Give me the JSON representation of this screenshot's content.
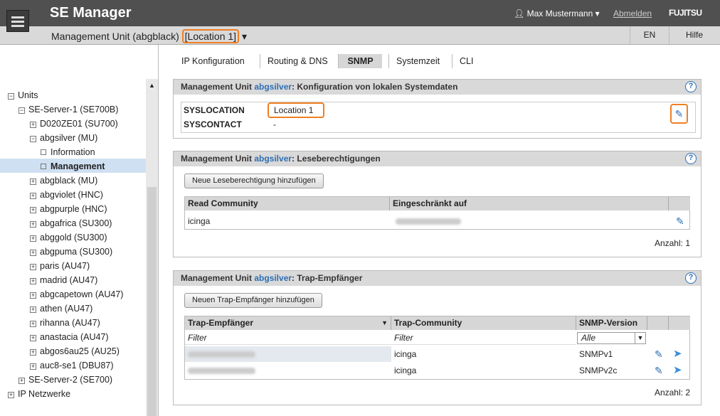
{
  "header": {
    "app_title": "SE Manager",
    "user": "Max Mustermann",
    "logout": "Abmelden",
    "logo": "FUJITSU"
  },
  "subheader": {
    "title_prefix": "Management Unit (abgblack) ",
    "location": "[Location 1]",
    "lang": "EN",
    "help": "Hilfe"
  },
  "sidebar": {
    "units": "Units",
    "server1": "SE-Server-1 (SE700B)",
    "d020": "D020ZE01 (SU700)",
    "abgsilver": "abgsilver (MU)",
    "information": "Information",
    "management": "Management",
    "items": [
      "abgblack (MU)",
      "abgviolet (HNC)",
      "abgpurple (HNC)",
      "abgafrica (SU300)",
      "abggold (SU300)",
      "abgpuma (SU300)",
      "paris (AU47)",
      "madrid (AU47)",
      "abgcapetown (AU47)",
      "athen (AU47)",
      "rihanna (AU47)",
      "anastacia (AU47)",
      "abgos6au25 (AU25)",
      "auc8-se1 (DBU87)"
    ],
    "server2": "SE-Server-2 (SE700)",
    "ipnet": "IP Netzwerke"
  },
  "tabs": [
    "IP Konfiguration",
    "Routing & DNS",
    "SNMP",
    "Systemzeit",
    "CLI"
  ],
  "panel1": {
    "prefix": "Management Unit ",
    "mu": "abgsilver",
    "suffix": ": Konfiguration von lokalen Systemdaten",
    "syslocation_label": "SYSLOCATION",
    "syslocation_value": "Location 1",
    "syscontact_label": "SYSCONTACT",
    "syscontact_value": "-"
  },
  "panel2": {
    "prefix": "Management Unit ",
    "mu": "abgsilver",
    "suffix": ": Leseberechtigungen",
    "add_button": "Neue Leseberechtigung hinzufügen",
    "col1": "Read Community",
    "col2": "Eingeschränkt auf",
    "row_community": "icinga",
    "count": "Anzahl: 1"
  },
  "panel3": {
    "prefix": "Management Unit ",
    "mu": "abgsilver",
    "suffix": ": Trap-Empfänger",
    "add_button": "Neuen Trap-Empfänger hinzufügen",
    "col1": "Trap-Empfänger",
    "col2": "Trap-Community",
    "col3": "SNMP-Version",
    "filter": "Filter",
    "filter_select": "Alle",
    "rows": [
      {
        "community": "icinga",
        "version": "SNMPv1"
      },
      {
        "community": "icinga",
        "version": "SNMPv2c"
      }
    ],
    "count": "Anzahl: 2"
  },
  "colors": {
    "accent": "#f07f22",
    "link": "#2d6eb5",
    "header": "#505050"
  }
}
